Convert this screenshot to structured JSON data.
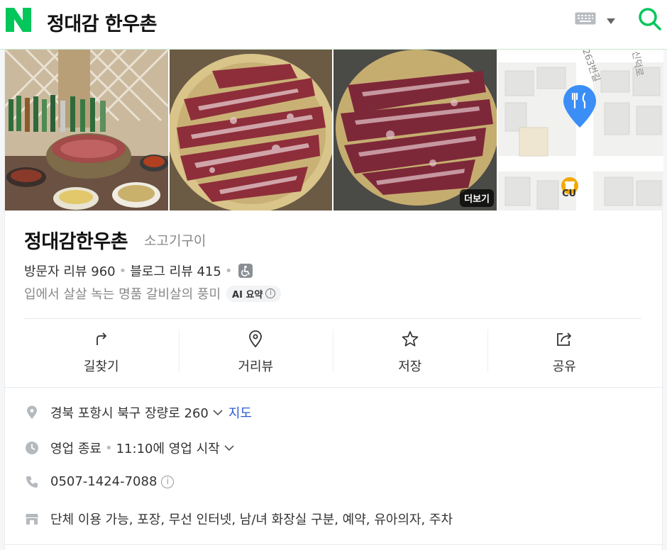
{
  "header": {
    "logo_letter": "N",
    "search_query": "정대감 한우촌",
    "icons": [
      "keyboard-icon",
      "chevron-down-icon",
      "search-icon"
    ],
    "brand_color": "#03c75a"
  },
  "photos": {
    "more_label": "더보기",
    "map": {
      "road_labels": [
        "263번길",
        "신덕로"
      ],
      "poi_label": "CU"
    }
  },
  "place": {
    "name": "정대감한우촌",
    "category": "소고기구이",
    "visitor_reviews": "방문자 리뷰 960",
    "blog_reviews": "블로그 리뷰 415",
    "tagline": "입에서 살살 녹는 명품 갈비살의 풍미",
    "ai_summary_label": "AI 요약"
  },
  "actions": [
    {
      "label": "길찾기",
      "icon": "directions-icon"
    },
    {
      "label": "거리뷰",
      "icon": "street-view-icon"
    },
    {
      "label": "저장",
      "icon": "star-icon"
    },
    {
      "label": "공유",
      "icon": "share-icon"
    }
  ],
  "details": {
    "address": "경북 포항시 북구 장량로 260",
    "map_link": "지도",
    "hours_status": "영업 종료",
    "hours_next": "11:10에 영업 시작",
    "phone": "0507-1424-7088",
    "amenities": "단체 이용 가능, 포장, 무선 인터넷, 남/녀 화장실 구분, 예약, 유아의자, 주차"
  }
}
